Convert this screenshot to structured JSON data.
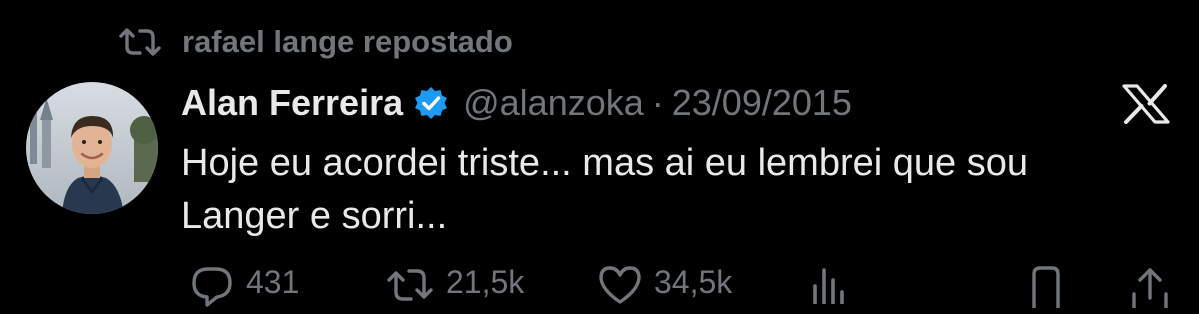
{
  "repost": {
    "icon": "repost-icon",
    "label": "rafael lange repostado"
  },
  "author": {
    "avatar": "avatar",
    "name": "Alan Ferreira",
    "verified_icon": "verified-badge-icon",
    "handle": "@alanzoka",
    "separator": "·",
    "date": "23/09/2015"
  },
  "brand": {
    "logo": "x-logo-icon"
  },
  "tweet": {
    "text": "Hoje eu acordei triste... mas ai eu lembrei que sou\nLanger e sorri..."
  },
  "actions": {
    "reply": {
      "icon": "reply-icon",
      "count": "431"
    },
    "repost": {
      "icon": "repost-icon",
      "count": "21,5k"
    },
    "like": {
      "icon": "heart-icon",
      "count": "34,5k"
    },
    "views": {
      "icon": "views-icon"
    },
    "bookmark": {
      "icon": "bookmark-icon"
    },
    "share": {
      "icon": "share-icon"
    }
  },
  "colors": {
    "background": "#000000",
    "text_primary": "#e7e9ea",
    "text_secondary": "#71767b",
    "verified": "#1d9bf0"
  }
}
